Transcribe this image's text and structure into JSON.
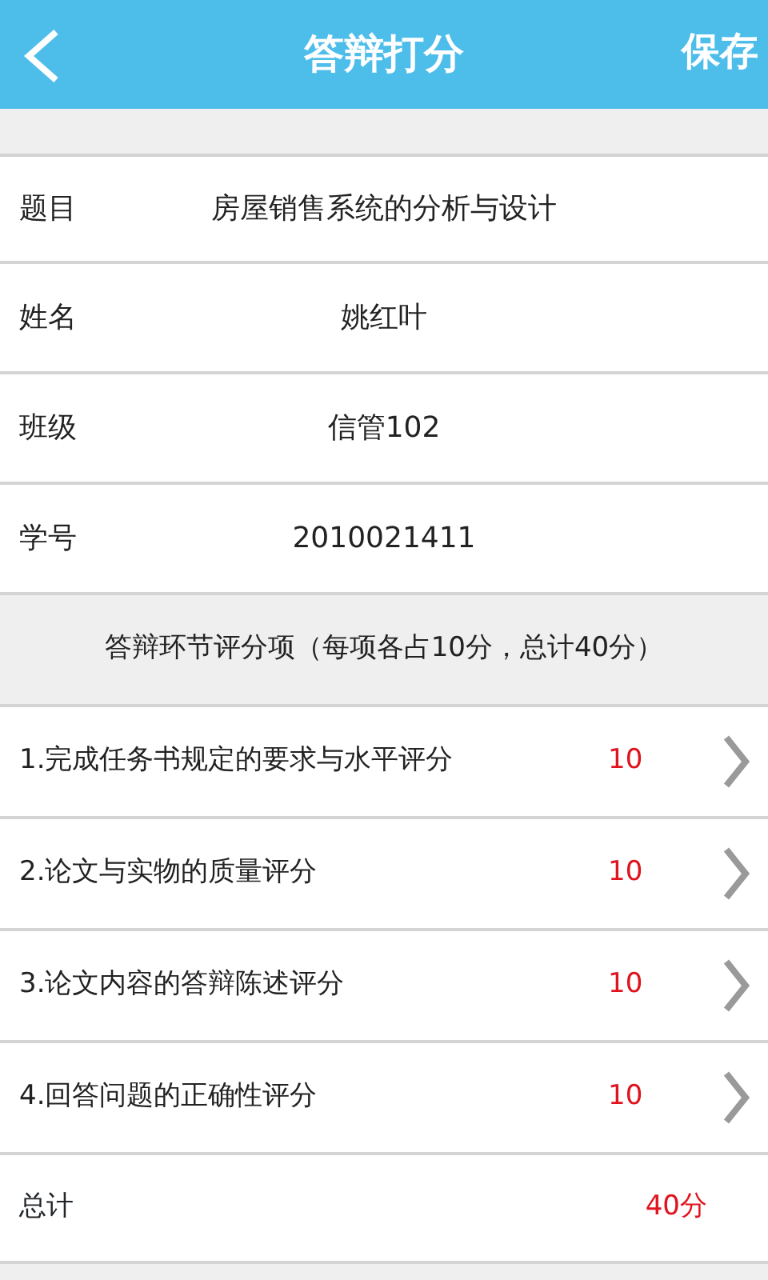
{
  "header": {
    "title": "答辩打分",
    "action": "保存"
  },
  "info": [
    {
      "label": "题目",
      "value": "房屋销售系统的分析与设计"
    },
    {
      "label": "姓名",
      "value": "姚红叶"
    },
    {
      "label": "班级",
      "value": "信管102"
    },
    {
      "label": "学号",
      "value": "2010021411"
    }
  ],
  "section_title": "答辩环节评分项（每项各占10分，总计40分）",
  "items": [
    {
      "label": "1.完成任务书规定的要求与水平评分",
      "score": "10"
    },
    {
      "label": "2.论文与实物的质量评分",
      "score": "10"
    },
    {
      "label": "3.论文内容的答辩陈述评分",
      "score": "10"
    },
    {
      "label": "4.回答问题的正确性评分",
      "score": "10"
    }
  ],
  "total": {
    "label": "总计",
    "value": "40分"
  }
}
